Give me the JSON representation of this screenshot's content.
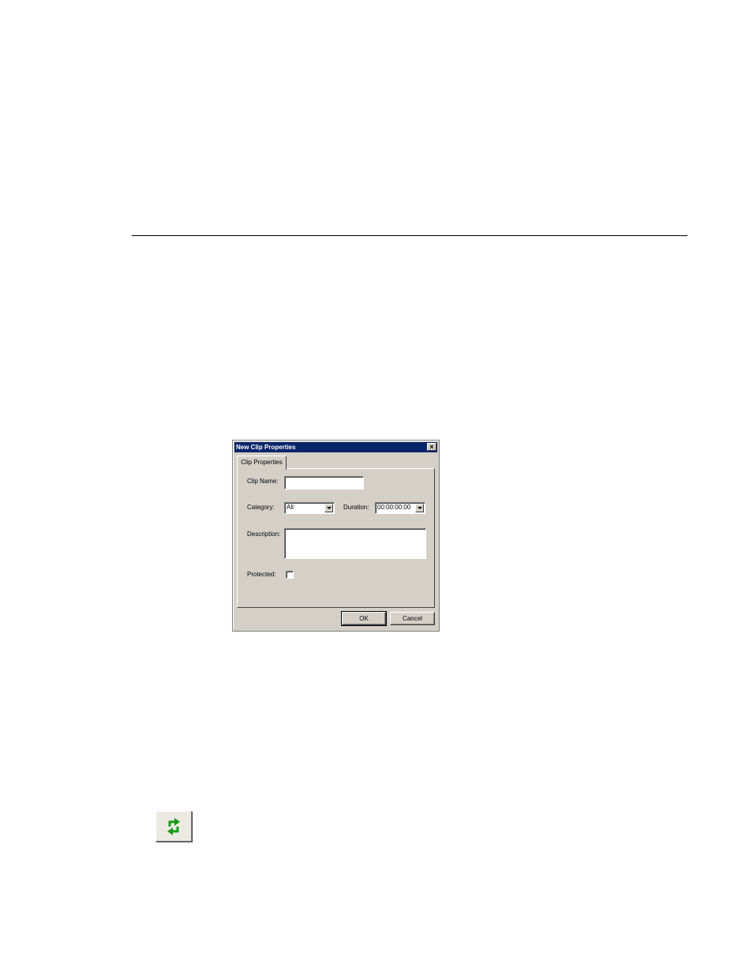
{
  "dialog": {
    "title": "New Clip Properties",
    "close_glyph": "×",
    "tab_label": "Clip Properties",
    "clip_name": {
      "label": "Clip Name:",
      "value": ""
    },
    "category": {
      "label": "Category:",
      "value": "All"
    },
    "duration": {
      "label": "Duration:",
      "value": "00:00:00:00"
    },
    "description": {
      "label": "Description:",
      "value": ""
    },
    "protected": {
      "label": "Protected:",
      "checked": false
    },
    "ok_label": "OK",
    "cancel_label": "Cancel"
  },
  "toolbar": {
    "refresh_icon": "refresh-icon",
    "icon_color": "#1a9a1a"
  }
}
